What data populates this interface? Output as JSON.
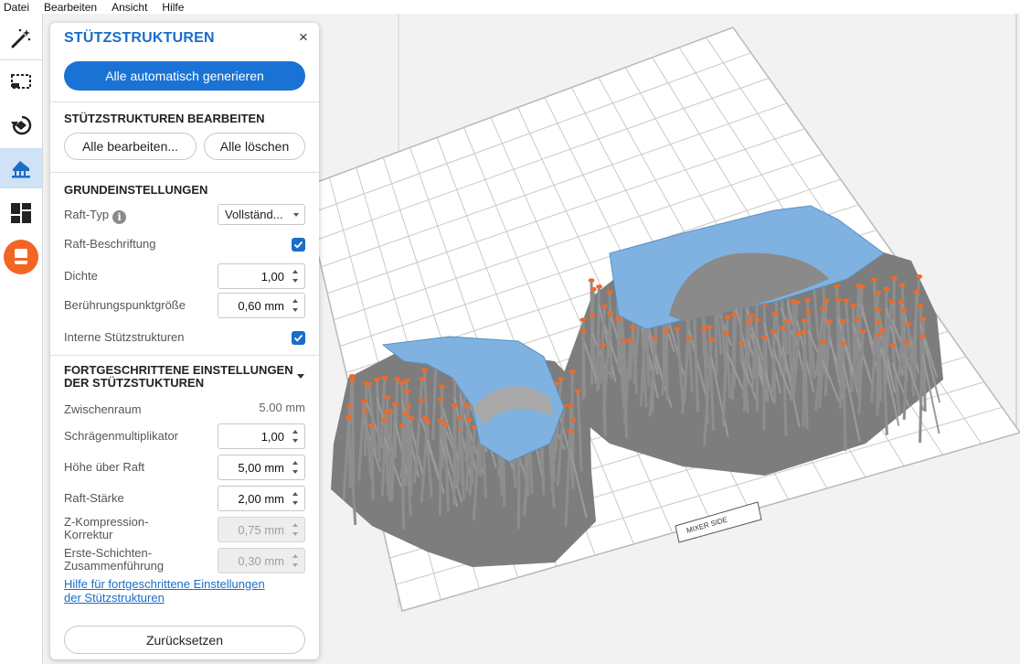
{
  "menu": {
    "items": [
      "Datei",
      "Bearbeiten",
      "Ansicht",
      "Hilfe"
    ]
  },
  "toolbar": {
    "tools": [
      {
        "icon": "magic-wand-icon",
        "active": false
      },
      {
        "icon": "select-region-icon",
        "active": false
      },
      {
        "icon": "orient-icon",
        "active": false
      },
      {
        "icon": "supports-icon",
        "active": true
      },
      {
        "icon": "layout-icon",
        "active": false
      },
      {
        "icon": "print-icon",
        "active": false,
        "color": "#f26522"
      }
    ]
  },
  "panel": {
    "title": "STÜTZSTRUKTUREN",
    "close_symbol": "×",
    "generate_all": "Alle automatisch generieren",
    "edit_section": {
      "title": "STÜTZSTRUKTUREN BEARBEITEN",
      "edit_all": "Alle bearbeiten...",
      "delete_all": "Alle löschen"
    },
    "basic": {
      "title": "GRUNDEINSTELLUNGEN",
      "raft_type_label": "Raft-Typ",
      "raft_type_value": "Vollständ...",
      "raft_label_label": "Raft-Beschriftung",
      "raft_label_checked": true,
      "density_label": "Dichte",
      "density_value": "1,00",
      "touchpoint_label": "Berührungspunktgröße",
      "touchpoint_value": "0,60 mm",
      "internal_label": "Interne Stützstrukturen",
      "internal_checked": true
    },
    "advanced": {
      "title_line1": "FORTGESCHRITTENE EINSTELLUNGEN",
      "title_line2": "DER STÜTZSTUKTUREN",
      "spacing_label": "Zwischenraum",
      "spacing_value": "5.00 mm",
      "slope_label": "Schrägenmultiplikator",
      "slope_value": "1,00",
      "height_label": "Höhe über Raft",
      "height_value": "5,00 mm",
      "thickness_label": "Raft-Stärke",
      "thickness_value": "2,00 mm",
      "zcomp_label_1": "Z-Kompression-",
      "zcomp_label_2": "Korrektur",
      "zcomp_value": "0,75 mm",
      "firstlayer_label_1": "Erste-Schichten-",
      "firstlayer_label_2": "Zusammenführung",
      "firstlayer_value": "0,30 mm",
      "help_link_1": "Hilfe für fortgeschrittene Einstellungen",
      "help_link_2": "der Stützstrukturen"
    },
    "reset": "Zurücksetzen"
  },
  "viewport": {
    "platform_label": "MIXER SIDE",
    "colors": {
      "model": "#7fb2e0",
      "support": "#8e8e8e",
      "touchpoint": "#ef6a2a",
      "grid": "#c9c9c9",
      "background": "#f2f2f2"
    }
  }
}
